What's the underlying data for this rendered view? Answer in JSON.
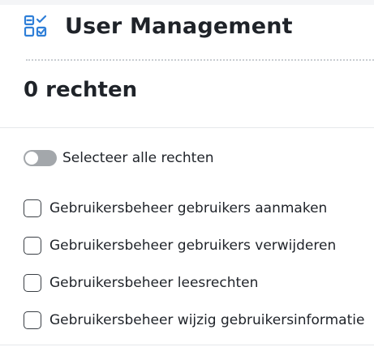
{
  "header": {
    "title": "User Management",
    "icon": "checklist-grid-icon",
    "accent_color": "#2f7fd8"
  },
  "rights_count": "0 rechten",
  "select_all": {
    "label": "Selecteer alle rechten",
    "checked": false
  },
  "rights": [
    {
      "label": "Gebruikersbeheer gebruikers aanmaken",
      "checked": false
    },
    {
      "label": "Gebruikersbeheer gebruikers verwijderen",
      "checked": false
    },
    {
      "label": "Gebruikersbeheer leesrechten",
      "checked": false
    },
    {
      "label": "Gebruikersbeheer wijzig gebruikersinformatie",
      "checked": false
    }
  ]
}
